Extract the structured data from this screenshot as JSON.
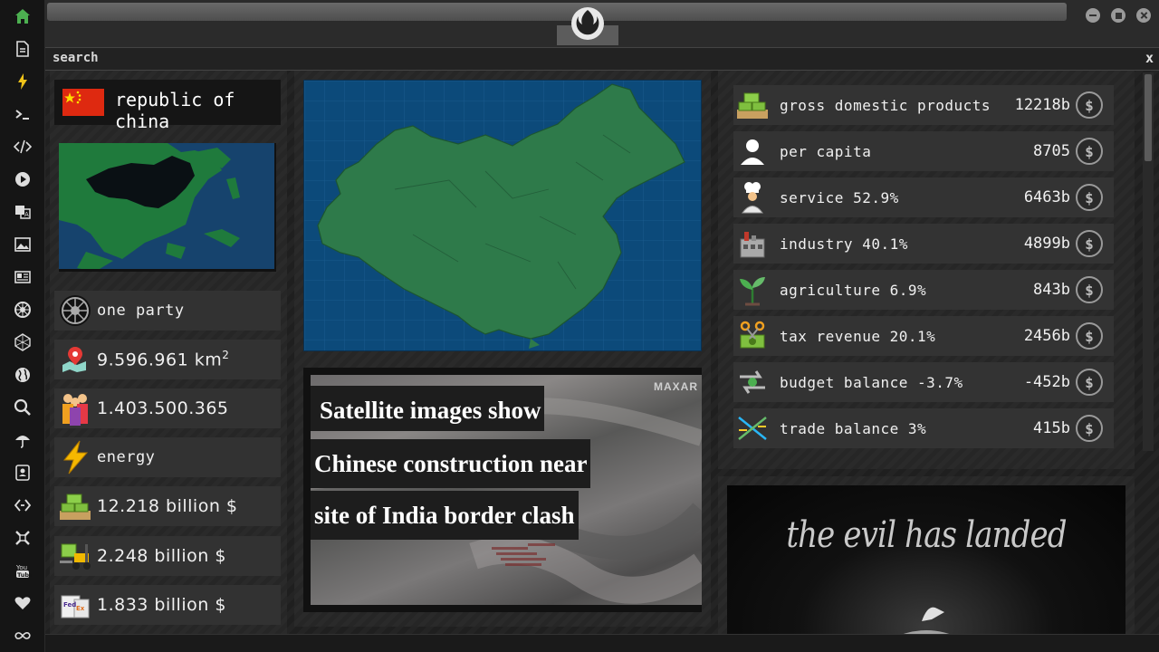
{
  "header": {
    "search_label": "search",
    "close_label": "x"
  },
  "rail_icons": [
    "home-icon",
    "document-icon",
    "lightning-icon",
    "terminal-icon",
    "code-icon",
    "play-icon",
    "translate-icon",
    "image-icon",
    "news-icon",
    "empire-icon",
    "hexagon-icon",
    "globe-icon",
    "search-icon",
    "umbrella-icon",
    "contact-icon",
    "transfer-icon",
    "crosshair-icon",
    "youtube-icon",
    "heart-icon",
    "infinity-icon"
  ],
  "country": {
    "name": "republic of china",
    "flag_color": "#de2910"
  },
  "stats": {
    "government": "one party",
    "area": "9.596.961 km",
    "area_sup": "2",
    "population": "1.403.500.365",
    "energy": "energy",
    "money_1": "12.218 billion $",
    "money_2": "2.248 billion $",
    "money_3": "1.833 billion $"
  },
  "news": {
    "source": "MAXAR",
    "line1": "Satellite images show",
    "line2": "Chinese construction near",
    "line3": "site of India border clash"
  },
  "economy": [
    {
      "label": "gross domestic products",
      "value": "12218b"
    },
    {
      "label": "per capita",
      "value": "8705"
    },
    {
      "label": "service 52.9%",
      "value": "6463b"
    },
    {
      "label": "industry 40.1%",
      "value": "4899b"
    },
    {
      "label": "agriculture 6.9%",
      "value": "843b"
    },
    {
      "label": "tax revenue 20.1%",
      "value": "2456b"
    },
    {
      "label": "budget balance -3.7%",
      "value": "-452b"
    },
    {
      "label": "trade balance 3%",
      "value": "415b"
    }
  ],
  "dollar_symbol": "$",
  "ad": {
    "tagline": "the evil has landed"
  },
  "colors": {
    "map_sea": "#0c4a7a",
    "map_land": "#2e7a4a",
    "accent_green": "#4caf50"
  }
}
